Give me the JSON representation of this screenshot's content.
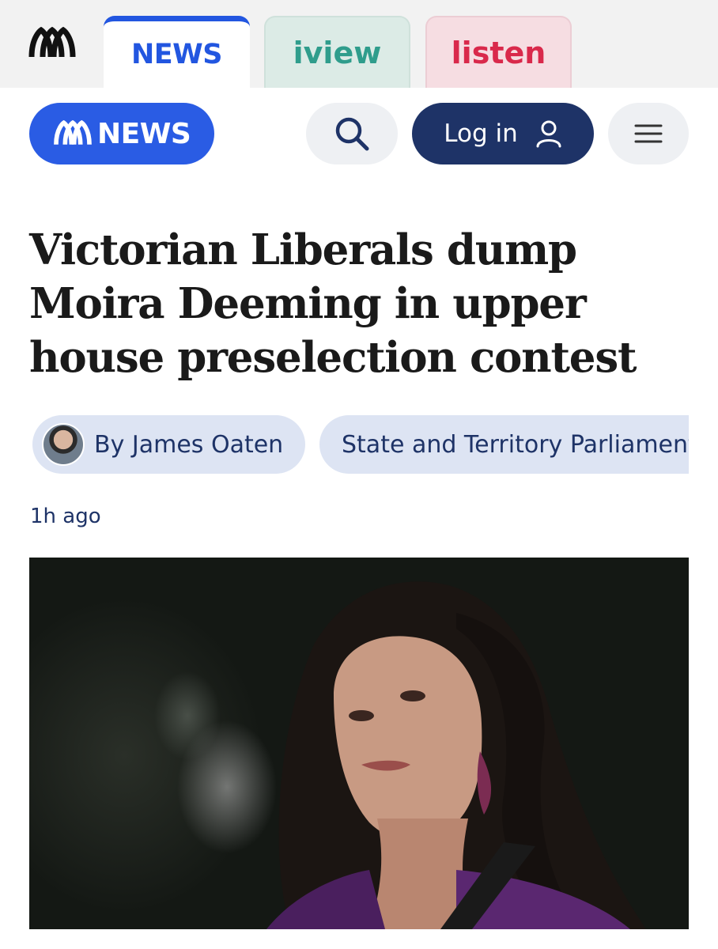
{
  "top_tabs": {
    "news": "NEWS",
    "iview": "iview",
    "listen": "listen"
  },
  "header": {
    "logo_text": "NEWS",
    "login_label": "Log in"
  },
  "article": {
    "headline": "Victorian Liberals dump Moira Deeming in upper house preselection contest",
    "author": "By James Oaten",
    "topic": "State and Territory Parliaments",
    "timestamp": "1h ago"
  },
  "colors": {
    "news_blue": "#2256e0",
    "navy": "#1e3367",
    "iview_green": "#2f9d8c",
    "listen_red": "#d9294b",
    "chip_bg": "#dde4f3"
  },
  "icons": [
    "abc-logo-icon",
    "search-icon",
    "user-icon",
    "hamburger-menu-icon"
  ]
}
